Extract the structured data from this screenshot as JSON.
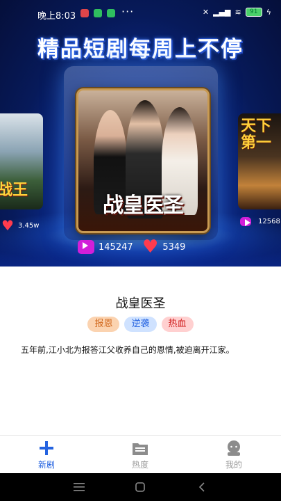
{
  "status_bar": {
    "time": "晚上8:03",
    "more": "···",
    "battery": "91"
  },
  "banner": {
    "title": "精品短剧每周上不停"
  },
  "carousel": {
    "left": {
      "poster_text": "战王",
      "likes": "3.45w"
    },
    "center": {
      "poster_text": "战皇医圣",
      "plays": "145247",
      "likes": "5349"
    },
    "right": {
      "poster_text": "天下第一",
      "plays": "12568"
    }
  },
  "detail": {
    "title": "战皇医圣",
    "tags": [
      {
        "label": "报恩",
        "bg": "#fbd3b0",
        "color": "#d2691e"
      },
      {
        "label": "逆袭",
        "bg": "#cfe2ff",
        "color": "#2463e0"
      },
      {
        "label": "热血",
        "bg": "#ffd0d0",
        "color": "#d02020"
      }
    ],
    "description": "五年前,江小北为报答江父收养自己的恩情,被迫离开江家。"
  },
  "tabbar": {
    "items": [
      {
        "label": "新剧",
        "icon": "plus-icon"
      },
      {
        "label": "热度",
        "icon": "folder-icon"
      },
      {
        "label": "我的",
        "icon": "profile-icon"
      }
    ],
    "active_color": "#2463e0"
  }
}
